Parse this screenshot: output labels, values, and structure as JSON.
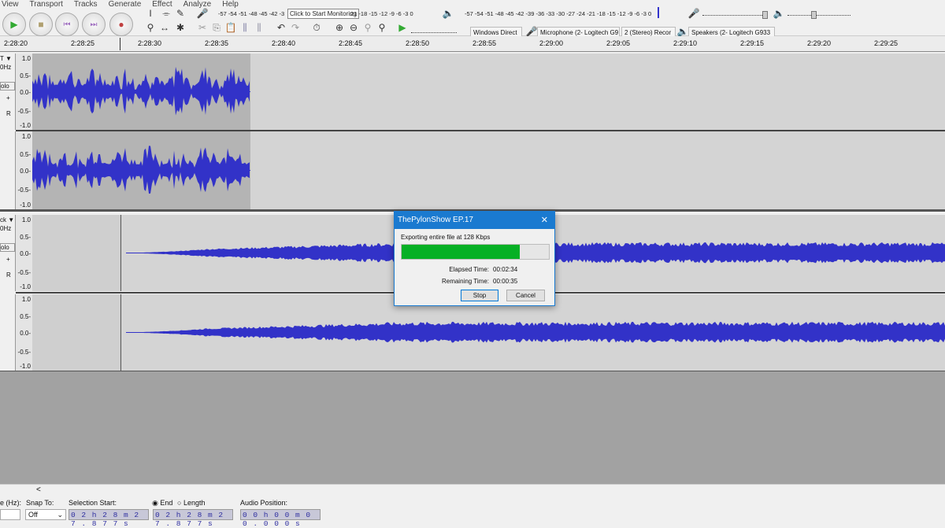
{
  "menu": [
    "View",
    "Transport",
    "Tracks",
    "Generate",
    "Effect",
    "Analyze",
    "Help"
  ],
  "transport": {
    "play": "play-icon",
    "stop": "stop-icon",
    "skip_start": "skip-start-icon",
    "skip_end": "skip-end-icon",
    "record": "record-icon"
  },
  "record_meter": {
    "scale": "-57 -54 -51 -48 -45 -42 -3",
    "monitor_label": "Click to Start Monitoring",
    "scale_end": "21 -18 -15 -12  -9  -6  -3  0",
    "lr": "L R"
  },
  "playback_meter": {
    "scale": "-57 -54 -51 -48 -45 -42 -39 -36 -33 -30 -27 -24 -21 -18 -15 -12  -9  -6  -3  0"
  },
  "devices": {
    "host": "Windows Direct",
    "microphone": "Microphone (2- Logitech G9",
    "channels": "2 (Stereo) Recor",
    "speakers": "Speakers (2- Logitech G933"
  },
  "ruler": [
    "2:28:20",
    "2:28:25",
    "2:28:30",
    "2:28:35",
    "2:28:40",
    "2:28:45",
    "2:28:50",
    "2:28:55",
    "2:29:00",
    "2:29:05",
    "2:29:10",
    "2:29:15",
    "2:29:20",
    "2:29:25"
  ],
  "tracks": [
    {
      "name_fragment": "T",
      "rate_fragment": "0Hz",
      "solo_fragment": "olo",
      "scale": [
        "1.0",
        "0.5-",
        "0.0-",
        "-0.5-",
        "-1.0"
      ]
    },
    {
      "name_fragment": "ck",
      "rate_fragment": "0Hz",
      "solo_fragment": "olo",
      "scale": [
        "1.0",
        "0.5-",
        "0.0-",
        "-0.5-",
        "-1.0"
      ]
    }
  ],
  "dialog": {
    "title": "ThePylonShow EP.17",
    "message": "Exporting entire file at 128 Kbps",
    "progress": 0.8,
    "elapsed_label": "Elapsed Time:",
    "elapsed": "00:02:34",
    "remaining_label": "Remaining Time:",
    "remaining": "00:00:35",
    "stop": "Stop",
    "cancel": "Cancel",
    "close": "✕"
  },
  "colors": {
    "waveform": "#3232c8",
    "progress": "#06b025",
    "title_bar": "#1a7ad0"
  },
  "bottom": {
    "rate_label": "e (Hz):",
    "snap_label": "Snap To:",
    "snap_value": "Off",
    "sel_start_label": "Selection Start:",
    "end_label": "End",
    "length_label": "Length",
    "audio_pos_label": "Audio Position:",
    "sel_start": "0 2 h 2 8 m 2 7 . 8 7 7 s",
    "sel_end": "0 2 h 2 8 m 2 7 . 8 7 7 s",
    "audio_pos": "0 0 h 0 0 m 0 0 . 0 0 0 s",
    "scroll_left": "<"
  }
}
